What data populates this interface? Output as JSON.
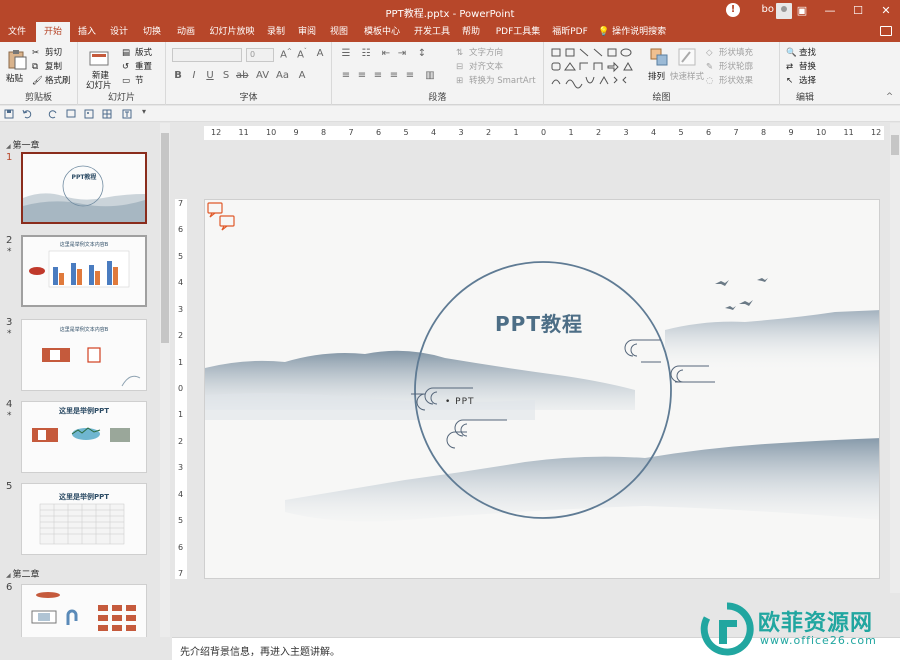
{
  "window": {
    "title": "PPT教程.pptx - PowerPoint",
    "user": "bo"
  },
  "menu": {
    "tabs": [
      "文件",
      "开始",
      "插入",
      "设计",
      "切换",
      "动画",
      "幻灯片放映",
      "录制",
      "审阅",
      "视图",
      "模板中心",
      "开发工具",
      "帮助",
      "PDF工具集",
      "福昕PDF"
    ],
    "active": "开始",
    "tell_me": "操作说明搜索"
  },
  "ribbon": {
    "clipboard": {
      "label": "剪贴板",
      "paste": "粘贴",
      "cut": "剪切",
      "copy": "复制",
      "format_painter": "格式刷"
    },
    "slides": {
      "label": "幻灯片",
      "new_slide": "新建",
      "new_slide2": "幻灯片",
      "layout": "版式",
      "reset": "重置",
      "section": "节"
    },
    "font": {
      "label": "字体",
      "size_value": "0"
    },
    "paragraph": {
      "label": "段落",
      "text_direction": "文字方向",
      "align_text": "对齐文本",
      "smartart": "转换为 SmartArt"
    },
    "drawing": {
      "label": "绘图",
      "arrange": "排列",
      "quick_styles": "快速样式",
      "shape_fill": "形状填充",
      "shape_outline": "形状轮廓",
      "shape_effects": "形状效果"
    },
    "editing": {
      "label": "编辑",
      "find": "查找",
      "replace": "替换",
      "select": "选择"
    }
  },
  "thumbnails": {
    "section1": "第一章",
    "section2": "第二章",
    "slides": [
      {
        "num": "1",
        "title": "PPT教程"
      },
      {
        "num": "2",
        "title": "这里是举例文本内容B"
      },
      {
        "num": "3",
        "title": "这里是举例文本内容B"
      },
      {
        "num": "4",
        "title": "这里是举例PPT"
      },
      {
        "num": "5",
        "title": "这里是举例PPT"
      },
      {
        "num": "6",
        "title": ""
      }
    ]
  },
  "ruler": {
    "h": [
      "12",
      "11",
      "10",
      "9",
      "8",
      "7",
      "6",
      "5",
      "4",
      "3",
      "2",
      "1",
      "0",
      "1",
      "2",
      "3",
      "4",
      "5",
      "6",
      "7",
      "8",
      "9",
      "10",
      "11",
      "12"
    ],
    "v": [
      "7",
      "6",
      "5",
      "4",
      "3",
      "2",
      "1",
      "0",
      "1",
      "2",
      "3",
      "4",
      "5",
      "6",
      "7"
    ]
  },
  "slide": {
    "title": "PPT教程",
    "subtitle": "• PPT"
  },
  "notes": {
    "text": "先介绍背景信息，再进入主题讲解。"
  },
  "watermark": {
    "name": "欧菲资源网",
    "url": "www.office26.com"
  },
  "colors": {
    "accent": "#b7472a",
    "ink": "#4d6e86"
  }
}
